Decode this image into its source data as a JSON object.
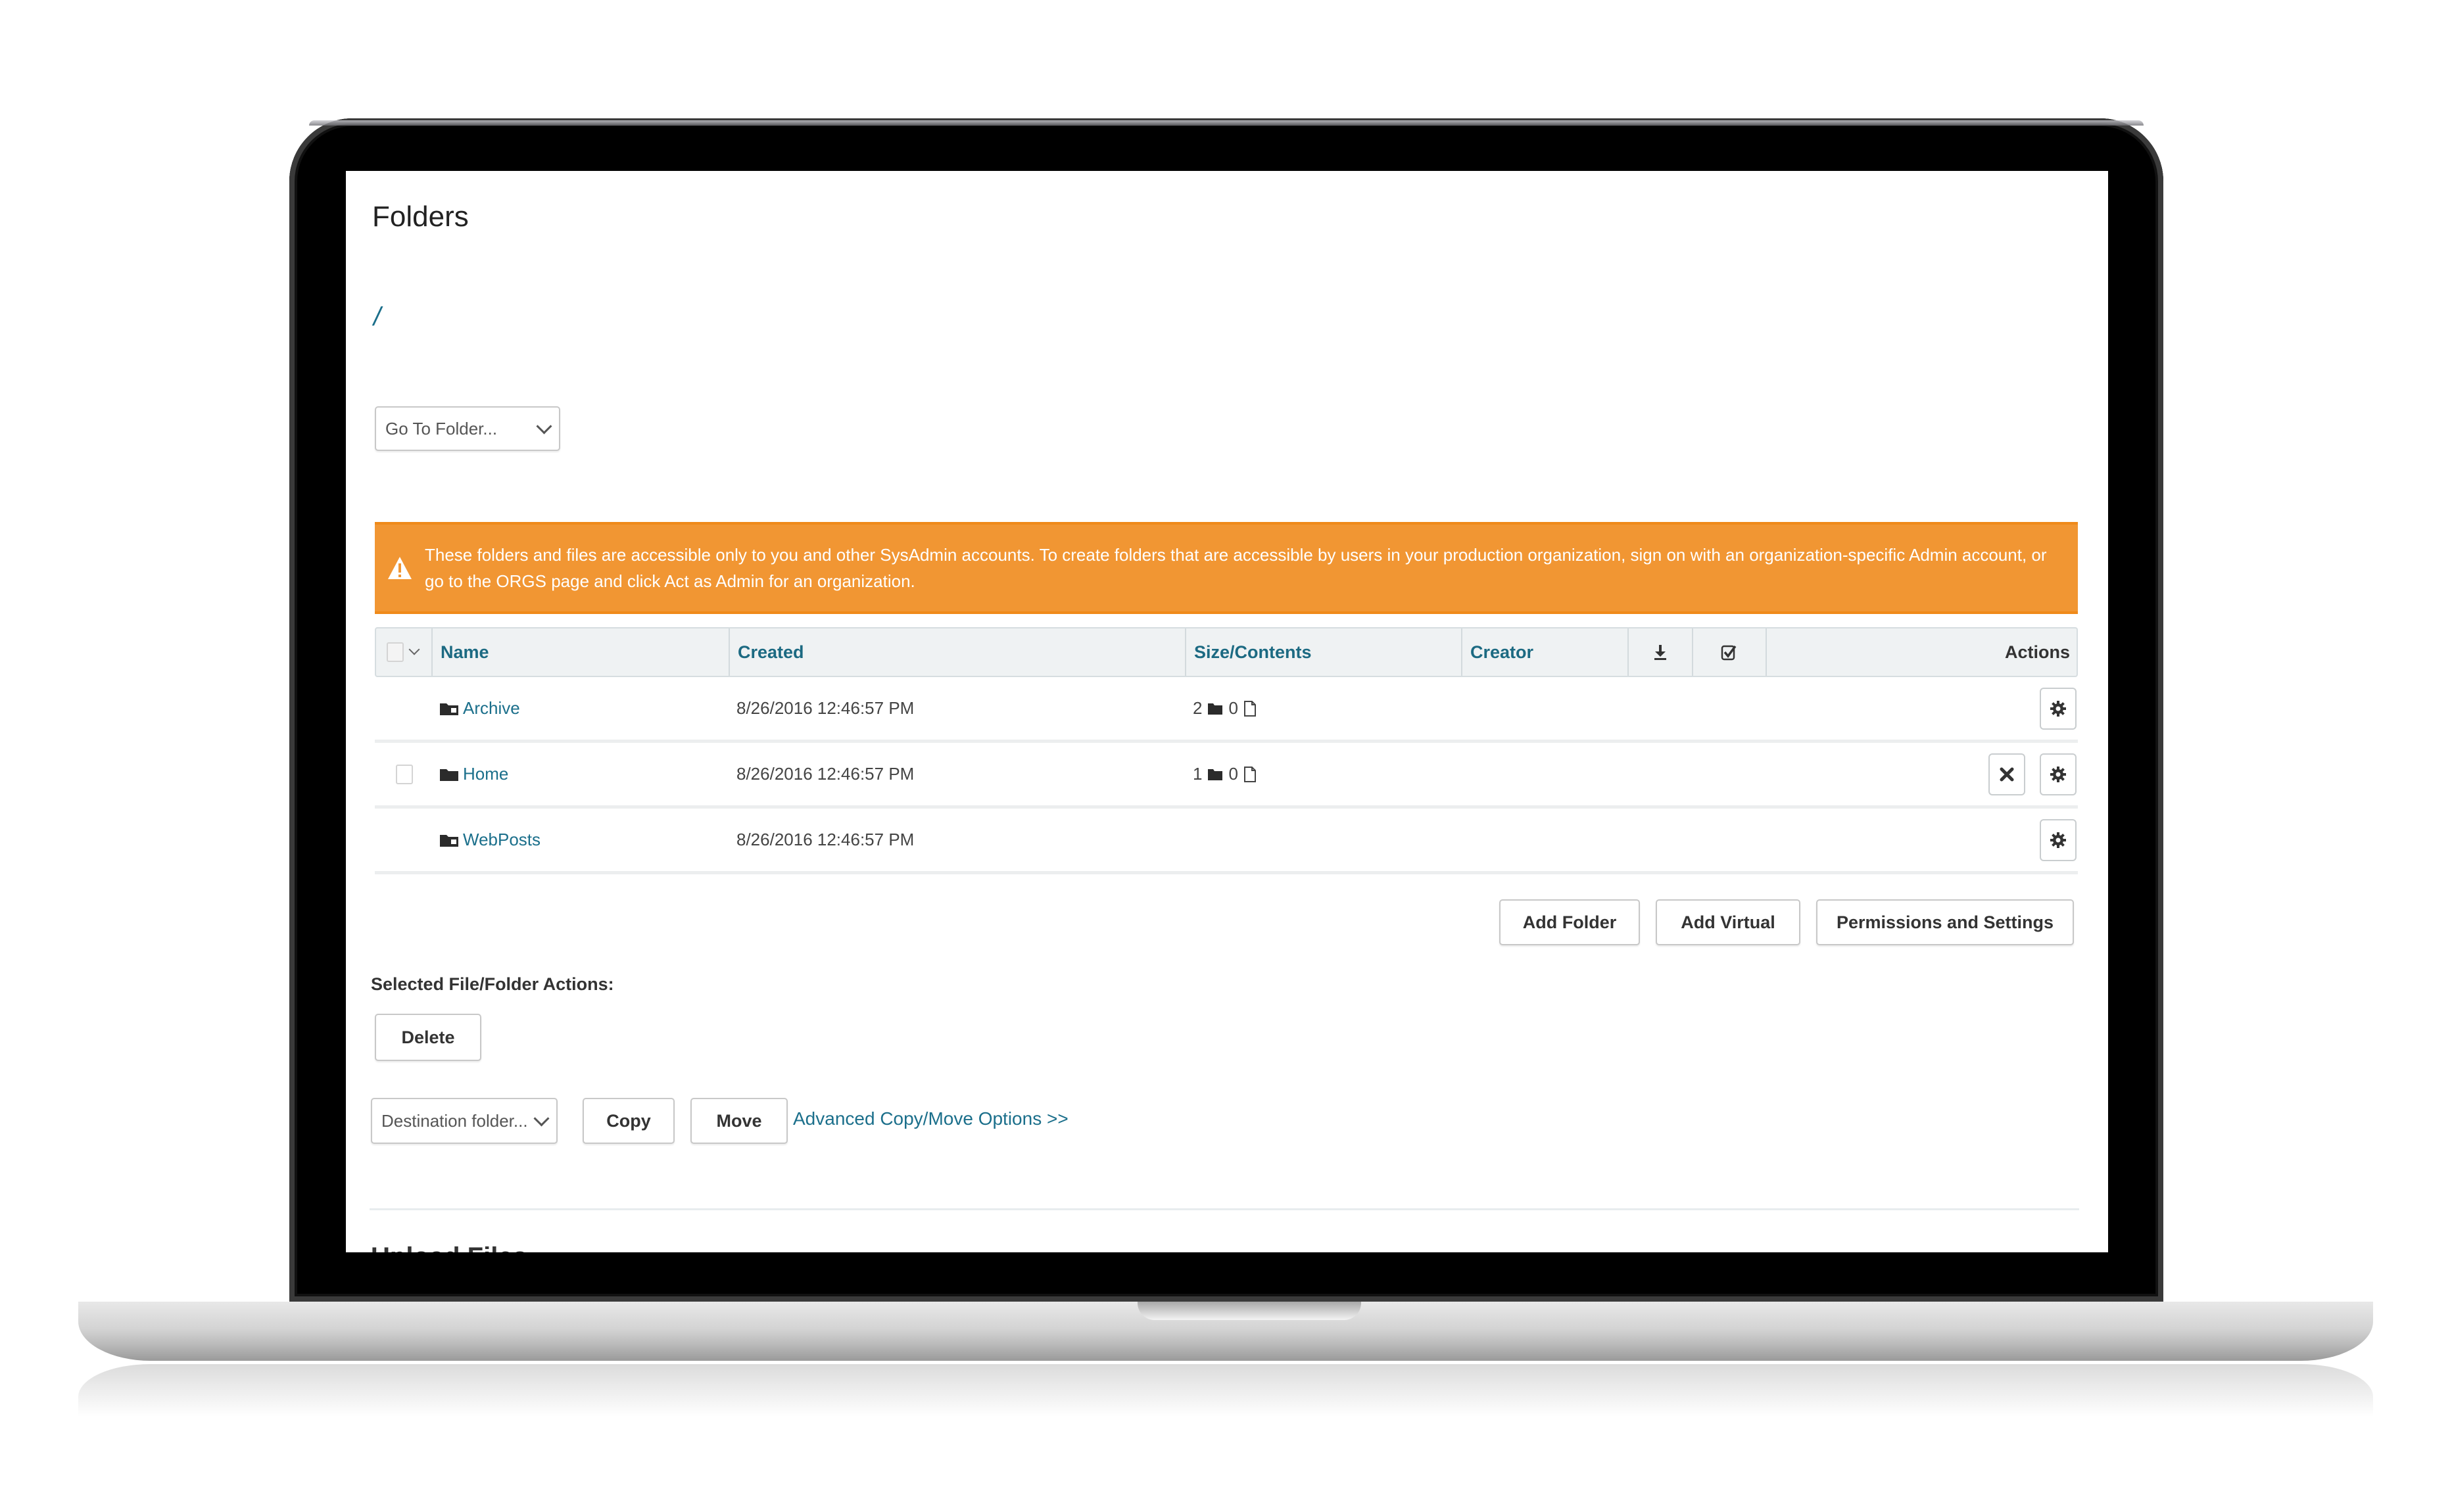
{
  "page": {
    "title": "Folders",
    "breadcrumb": "/"
  },
  "goto_folder": {
    "selected": "Go To Folder..."
  },
  "warning": {
    "icon": "warning-triangle-icon",
    "color": "#f19633",
    "text": "These folders and files are accessible only to you and other SysAdmin accounts. To create folders that are accessible by users in your production organization, sign on with an organization-specific Admin account, or go to the ORGS page and click Act as Admin for an organization."
  },
  "table": {
    "columns": {
      "name": "Name",
      "created": "Created",
      "size": "Size/Contents",
      "creator": "Creator",
      "download_icon": "download-icon",
      "select_icon": "checkbox-check-icon",
      "actions": "Actions"
    },
    "rows": [
      {
        "name": "Archive",
        "icon": "virtual-folder-icon",
        "selectable": false,
        "created": "8/26/2016 12:46:57 PM",
        "folders": "2",
        "files": "0",
        "creator": "",
        "actions": [
          "settings"
        ]
      },
      {
        "name": "Home",
        "icon": "folder-icon",
        "selectable": true,
        "created": "8/26/2016 12:46:57 PM",
        "folders": "1",
        "files": "0",
        "creator": "",
        "actions": [
          "delete",
          "settings"
        ]
      },
      {
        "name": "WebPosts",
        "icon": "virtual-folder-icon",
        "selectable": false,
        "created": "8/26/2016 12:46:57 PM",
        "folders": "",
        "files": "",
        "creator": "",
        "actions": [
          "settings"
        ]
      }
    ]
  },
  "buttons": {
    "add_folder": "Add Folder",
    "add_virtual": "Add Virtual",
    "permissions": "Permissions and Settings",
    "delete": "Delete",
    "copy": "Copy",
    "move": "Move"
  },
  "selected_actions": {
    "label": "Selected File/Folder Actions:",
    "destination_selected": "Destination folder...",
    "advanced_link": "Advanced Copy/Move Options >>"
  },
  "upload": {
    "title": "Upload Files"
  },
  "colors": {
    "link": "#1b6f8b",
    "warning": "#f19633",
    "header_bg": "#eff2f3"
  }
}
